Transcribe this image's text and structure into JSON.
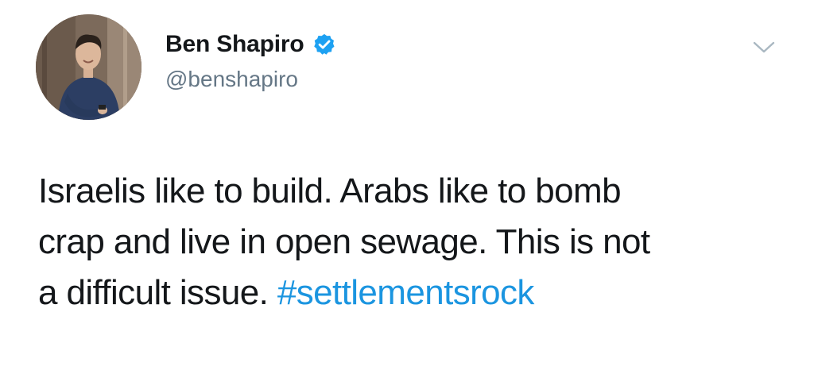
{
  "author": {
    "display_name": "Ben Shapiro",
    "handle": "@benshapiro",
    "verified": true,
    "verified_icon": "verified-badge-icon"
  },
  "menu": {
    "icon": "chevron-down-icon"
  },
  "tweet": {
    "lines": [
      "Israelis like to build. Arabs like to bomb",
      "crap and live in open sewage. This is not",
      "a difficult issue. "
    ],
    "hashtag": "#settlementsrock"
  },
  "colors": {
    "text": "#14171a",
    "secondary": "#657786",
    "link": "#1b95e0",
    "verified": "#1da1f2"
  }
}
